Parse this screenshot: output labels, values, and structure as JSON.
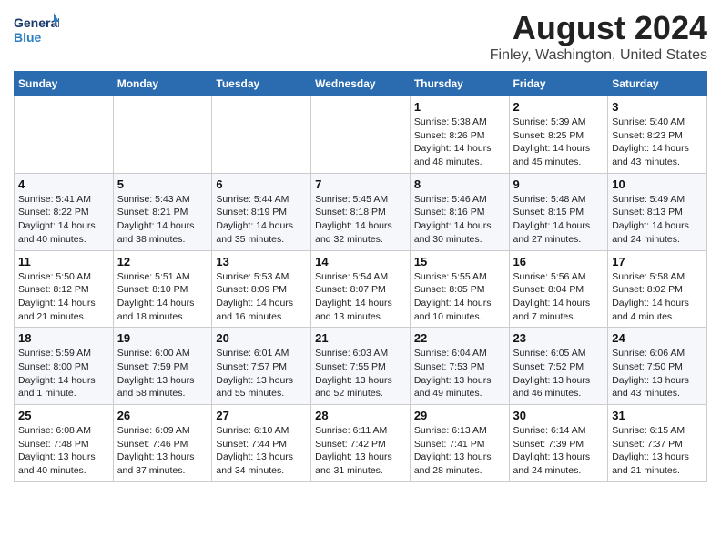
{
  "header": {
    "logo_line1": "General",
    "logo_line2": "Blue",
    "month": "August 2024",
    "location": "Finley, Washington, United States"
  },
  "weekdays": [
    "Sunday",
    "Monday",
    "Tuesday",
    "Wednesday",
    "Thursday",
    "Friday",
    "Saturday"
  ],
  "weeks": [
    [
      {
        "day": "",
        "detail": ""
      },
      {
        "day": "",
        "detail": ""
      },
      {
        "day": "",
        "detail": ""
      },
      {
        "day": "",
        "detail": ""
      },
      {
        "day": "1",
        "detail": "Sunrise: 5:38 AM\nSunset: 8:26 PM\nDaylight: 14 hours\nand 48 minutes."
      },
      {
        "day": "2",
        "detail": "Sunrise: 5:39 AM\nSunset: 8:25 PM\nDaylight: 14 hours\nand 45 minutes."
      },
      {
        "day": "3",
        "detail": "Sunrise: 5:40 AM\nSunset: 8:23 PM\nDaylight: 14 hours\nand 43 minutes."
      }
    ],
    [
      {
        "day": "4",
        "detail": "Sunrise: 5:41 AM\nSunset: 8:22 PM\nDaylight: 14 hours\nand 40 minutes."
      },
      {
        "day": "5",
        "detail": "Sunrise: 5:43 AM\nSunset: 8:21 PM\nDaylight: 14 hours\nand 38 minutes."
      },
      {
        "day": "6",
        "detail": "Sunrise: 5:44 AM\nSunset: 8:19 PM\nDaylight: 14 hours\nand 35 minutes."
      },
      {
        "day": "7",
        "detail": "Sunrise: 5:45 AM\nSunset: 8:18 PM\nDaylight: 14 hours\nand 32 minutes."
      },
      {
        "day": "8",
        "detail": "Sunrise: 5:46 AM\nSunset: 8:16 PM\nDaylight: 14 hours\nand 30 minutes."
      },
      {
        "day": "9",
        "detail": "Sunrise: 5:48 AM\nSunset: 8:15 PM\nDaylight: 14 hours\nand 27 minutes."
      },
      {
        "day": "10",
        "detail": "Sunrise: 5:49 AM\nSunset: 8:13 PM\nDaylight: 14 hours\nand 24 minutes."
      }
    ],
    [
      {
        "day": "11",
        "detail": "Sunrise: 5:50 AM\nSunset: 8:12 PM\nDaylight: 14 hours\nand 21 minutes."
      },
      {
        "day": "12",
        "detail": "Sunrise: 5:51 AM\nSunset: 8:10 PM\nDaylight: 14 hours\nand 18 minutes."
      },
      {
        "day": "13",
        "detail": "Sunrise: 5:53 AM\nSunset: 8:09 PM\nDaylight: 14 hours\nand 16 minutes."
      },
      {
        "day": "14",
        "detail": "Sunrise: 5:54 AM\nSunset: 8:07 PM\nDaylight: 14 hours\nand 13 minutes."
      },
      {
        "day": "15",
        "detail": "Sunrise: 5:55 AM\nSunset: 8:05 PM\nDaylight: 14 hours\nand 10 minutes."
      },
      {
        "day": "16",
        "detail": "Sunrise: 5:56 AM\nSunset: 8:04 PM\nDaylight: 14 hours\nand 7 minutes."
      },
      {
        "day": "17",
        "detail": "Sunrise: 5:58 AM\nSunset: 8:02 PM\nDaylight: 14 hours\nand 4 minutes."
      }
    ],
    [
      {
        "day": "18",
        "detail": "Sunrise: 5:59 AM\nSunset: 8:00 PM\nDaylight: 14 hours\nand 1 minute."
      },
      {
        "day": "19",
        "detail": "Sunrise: 6:00 AM\nSunset: 7:59 PM\nDaylight: 13 hours\nand 58 minutes."
      },
      {
        "day": "20",
        "detail": "Sunrise: 6:01 AM\nSunset: 7:57 PM\nDaylight: 13 hours\nand 55 minutes."
      },
      {
        "day": "21",
        "detail": "Sunrise: 6:03 AM\nSunset: 7:55 PM\nDaylight: 13 hours\nand 52 minutes."
      },
      {
        "day": "22",
        "detail": "Sunrise: 6:04 AM\nSunset: 7:53 PM\nDaylight: 13 hours\nand 49 minutes."
      },
      {
        "day": "23",
        "detail": "Sunrise: 6:05 AM\nSunset: 7:52 PM\nDaylight: 13 hours\nand 46 minutes."
      },
      {
        "day": "24",
        "detail": "Sunrise: 6:06 AM\nSunset: 7:50 PM\nDaylight: 13 hours\nand 43 minutes."
      }
    ],
    [
      {
        "day": "25",
        "detail": "Sunrise: 6:08 AM\nSunset: 7:48 PM\nDaylight: 13 hours\nand 40 minutes."
      },
      {
        "day": "26",
        "detail": "Sunrise: 6:09 AM\nSunset: 7:46 PM\nDaylight: 13 hours\nand 37 minutes."
      },
      {
        "day": "27",
        "detail": "Sunrise: 6:10 AM\nSunset: 7:44 PM\nDaylight: 13 hours\nand 34 minutes."
      },
      {
        "day": "28",
        "detail": "Sunrise: 6:11 AM\nSunset: 7:42 PM\nDaylight: 13 hours\nand 31 minutes."
      },
      {
        "day": "29",
        "detail": "Sunrise: 6:13 AM\nSunset: 7:41 PM\nDaylight: 13 hours\nand 28 minutes."
      },
      {
        "day": "30",
        "detail": "Sunrise: 6:14 AM\nSunset: 7:39 PM\nDaylight: 13 hours\nand 24 minutes."
      },
      {
        "day": "31",
        "detail": "Sunrise: 6:15 AM\nSunset: 7:37 PM\nDaylight: 13 hours\nand 21 minutes."
      }
    ]
  ]
}
